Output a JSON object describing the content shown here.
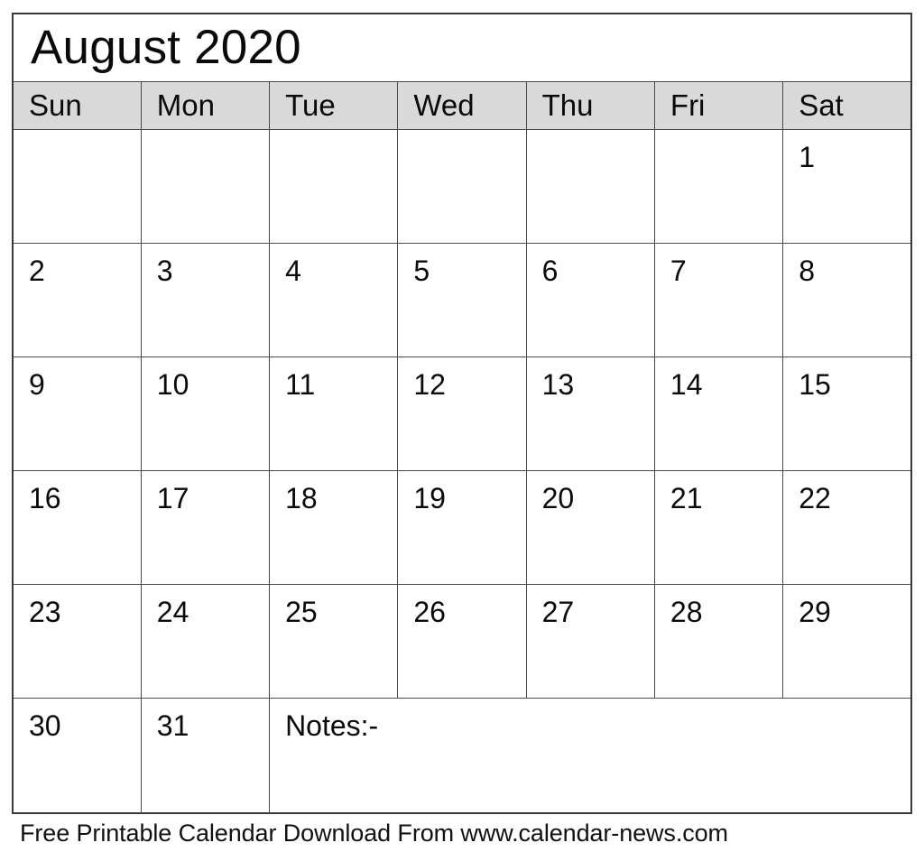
{
  "document": {
    "type": "printable-monthly-calendar",
    "title": "August 2020"
  },
  "calendar": {
    "month_title": "August 2020",
    "month": "August",
    "year": "2020",
    "weekday_headers": [
      "Sun",
      "Mon",
      "Tue",
      "Wed",
      "Thu",
      "Fri",
      "Sat"
    ],
    "header_background": "#d9d9d9",
    "grid_border_color": "#4a4a4a",
    "outer_border_color": "#3a3a3a",
    "page_background": "#ffffff",
    "text_color": "#0a0a0a",
    "weeks": [
      [
        "",
        "",
        "",
        "",
        "",
        "",
        "1"
      ],
      [
        "2",
        "3",
        "4",
        "5",
        "6",
        "7",
        "8"
      ],
      [
        "9",
        "10",
        "11",
        "12",
        "13",
        "14",
        "15"
      ],
      [
        "16",
        "17",
        "18",
        "19",
        "20",
        "21",
        "22"
      ],
      [
        "23",
        "24",
        "25",
        "26",
        "27",
        "28",
        "29"
      ]
    ],
    "last_row": {
      "days": [
        "30",
        "31"
      ],
      "notes_label": "Notes:-",
      "notes_colspan": 5,
      "notes_value": ""
    }
  },
  "footer": {
    "text": "Free Printable Calendar Download From www.calendar-news.com"
  }
}
